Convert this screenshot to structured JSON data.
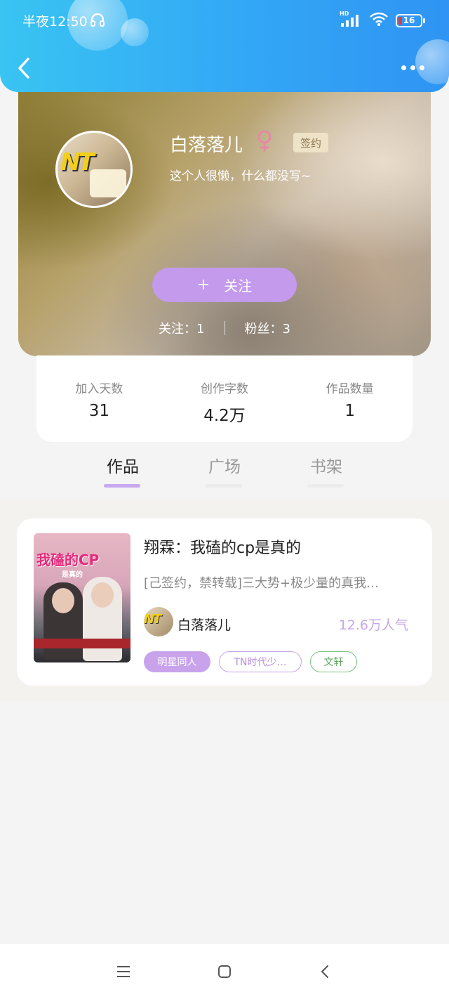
{
  "status_bar": {
    "time": "半夜12:50",
    "network": "HD",
    "battery": "16"
  },
  "colors": {
    "header_blue": "#33a7f6",
    "accent_purple": "#c39aec",
    "tag_green": "#7ac27c",
    "low_battery_red": "#e03a3a"
  },
  "profile": {
    "name": "白落落儿",
    "gender_icon": "female-icon",
    "badge": "签约",
    "bio": "这个人很懒，什么都没写~",
    "follow_button": "关注",
    "following": "关注：1",
    "fans": "粉丝：3"
  },
  "stats": [
    {
      "label": "加入天数",
      "value": "31"
    },
    {
      "label": "创作字数",
      "value": "4.2万"
    },
    {
      "label": "作品数量",
      "value": "1"
    }
  ],
  "tabs": [
    {
      "label": "作品",
      "active": true
    },
    {
      "label": "广场",
      "active": false
    },
    {
      "label": "书架",
      "active": false
    }
  ],
  "books": [
    {
      "cover_title": "我磕的CP",
      "cover_subtitle": "是真的",
      "title": "翔霖：我磕的cp是真的",
      "description": "[己签约，禁转载]三大势+极少量的真我…",
      "author": "白落落儿",
      "popularity": "12.6万人气",
      "tags": [
        "明星同人",
        "TN时代少…",
        "文轩"
      ]
    }
  ]
}
